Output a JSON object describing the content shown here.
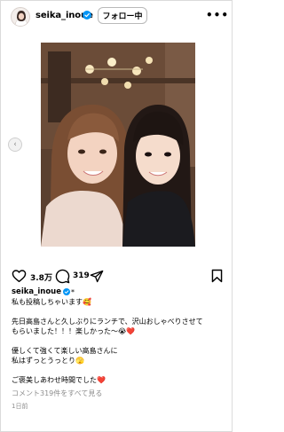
{
  "header": {
    "username": "seika_inoue",
    "follow_label": "フォロー中",
    "more_label": "•••"
  },
  "media": {
    "prev_label": "‹"
  },
  "actions": {
    "like_count": "3.8万",
    "comment_count": "319"
  },
  "caption": {
    "username": "seika_inoue",
    "star": "*",
    "lines": [
      "私も投稿しちゃいます🥰",
      "",
      "先日高島さんと久しぶりにランチで、沢山おしゃべりさせて",
      "もらいました！！！楽しかった〜😭❤️",
      "",
      "優しくて強くて楽しい高島さんに",
      "私はずっとうっとり🫣",
      "",
      "ご褒美しあわせ時間でした❤️"
    ]
  },
  "view_comments_label": "コメント319件をすべて見る",
  "time_ago": "1日前",
  "colors": {
    "verified": "#0095f6",
    "muted_text": "#8e8e8e",
    "border": "#dbdbdb"
  }
}
